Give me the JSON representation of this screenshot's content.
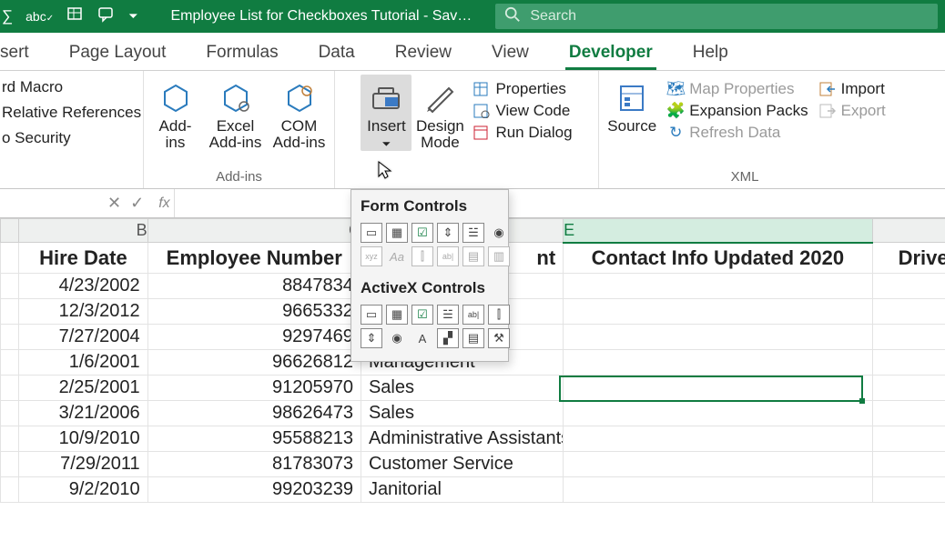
{
  "titlebar": {
    "doc_title": "Employee List for Checkboxes Tutorial  -  Sav…",
    "search_placeholder": "Search"
  },
  "tabs": {
    "t0": "sert",
    "t1": "Page Layout",
    "t2": "Formulas",
    "t3": "Data",
    "t4": "Review",
    "t5": "View",
    "t6": "Developer",
    "t7": "Help"
  },
  "ribbon": {
    "code_items": {
      "c0": "rd Macro",
      "c1": "Relative References",
      "c2": "o Security"
    },
    "addins": {
      "lbl0a": "Add-",
      "lbl0b": "ins",
      "lbl1a": "Excel",
      "lbl1b": "Add-ins",
      "lbl2a": "COM",
      "lbl2b": "Add-ins",
      "group": "Add-ins"
    },
    "controls": {
      "insert": "Insert",
      "design_a": "Design",
      "design_b": "Mode",
      "prop": "Properties",
      "viewcode": "View Code",
      "rundlg": "Run Dialog"
    },
    "xml": {
      "source": "Source",
      "mapprop": "Map Properties",
      "expansion": "Expansion Packs",
      "refresh": "Refresh Data",
      "import": "Import",
      "export": "Export",
      "group": "XML"
    }
  },
  "dropdown": {
    "hdr1": "Form Controls",
    "hdr2": "ActiveX Controls"
  },
  "formula_bar": {
    "fx": "fx"
  },
  "columns": {
    "B": "B",
    "C": "C",
    "E": "E"
  },
  "headers": {
    "B": "Hire Date",
    "C": "Employee Number",
    "D": "nt",
    "E": "Contact Info Updated 2020",
    "F": "Driver S"
  },
  "rows": [
    {
      "date": "4/23/2002",
      "num": "8847834",
      "dept": ""
    },
    {
      "date": "12/3/2012",
      "num": "9665332",
      "dept": ""
    },
    {
      "date": "7/27/2004",
      "num": "9297469",
      "dept": ""
    },
    {
      "date": "1/6/2001",
      "num": "96626812",
      "dept": "Management"
    },
    {
      "date": "2/25/2001",
      "num": "91205970",
      "dept": "Sales"
    },
    {
      "date": "3/21/2006",
      "num": "98626473",
      "dept": "Sales"
    },
    {
      "date": "10/9/2010",
      "num": "95588213",
      "dept": "Administrative Assistants"
    },
    {
      "date": "7/29/2011",
      "num": "81783073",
      "dept": "Customer Service"
    },
    {
      "date": "9/2/2010",
      "num": "99203239",
      "dept": "Janitorial"
    }
  ]
}
